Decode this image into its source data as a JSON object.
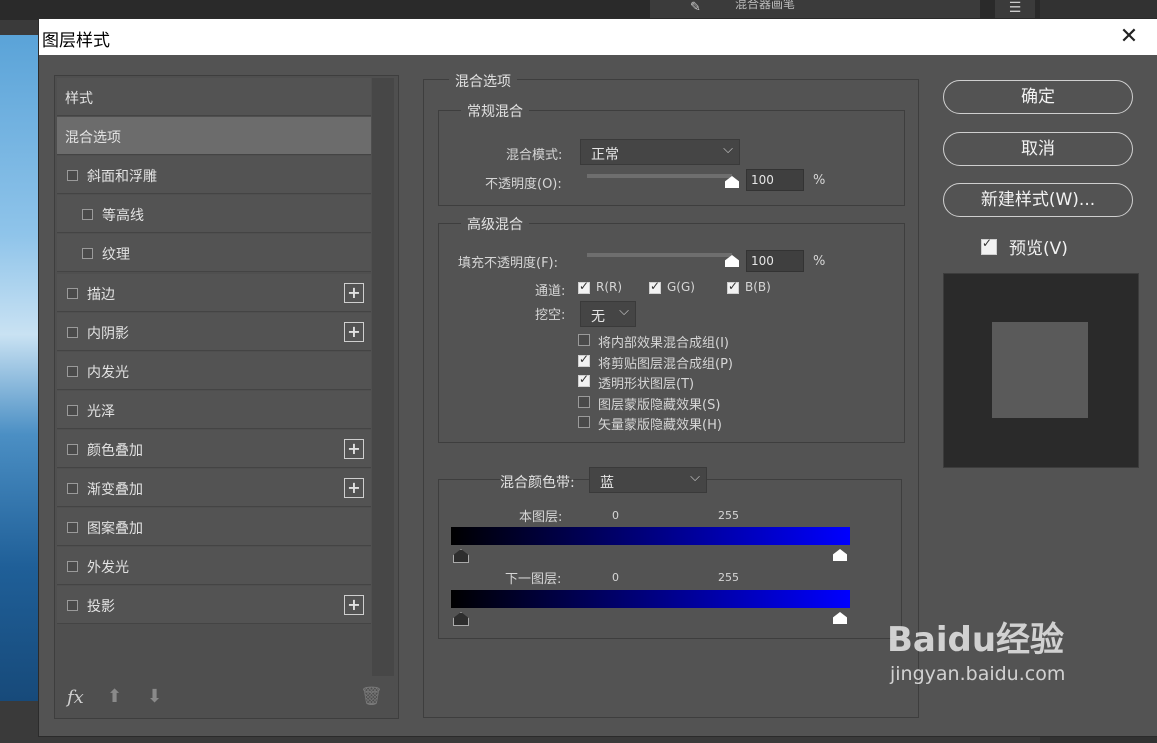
{
  "dialog": {
    "title": "图层样式"
  },
  "left_panel": {
    "items": [
      {
        "label": "样式",
        "checkbox": false,
        "plus": false,
        "indent": 0,
        "selected": false
      },
      {
        "label": "混合选项",
        "checkbox": false,
        "plus": false,
        "indent": 0,
        "selected": true
      },
      {
        "label": "斜面和浮雕",
        "checkbox": true,
        "plus": false,
        "indent": 0,
        "selected": false
      },
      {
        "label": "等高线",
        "checkbox": true,
        "plus": false,
        "indent": 1,
        "selected": false
      },
      {
        "label": "纹理",
        "checkbox": true,
        "plus": false,
        "indent": 1,
        "selected": false
      },
      {
        "label": "描边",
        "checkbox": true,
        "plus": true,
        "indent": 0,
        "selected": false
      },
      {
        "label": "内阴影",
        "checkbox": true,
        "plus": true,
        "indent": 0,
        "selected": false
      },
      {
        "label": "内发光",
        "checkbox": true,
        "plus": false,
        "indent": 0,
        "selected": false
      },
      {
        "label": "光泽",
        "checkbox": true,
        "plus": false,
        "indent": 0,
        "selected": false
      },
      {
        "label": "颜色叠加",
        "checkbox": true,
        "plus": true,
        "indent": 0,
        "selected": false
      },
      {
        "label": "渐变叠加",
        "checkbox": true,
        "plus": true,
        "indent": 0,
        "selected": false
      },
      {
        "label": "图案叠加",
        "checkbox": true,
        "plus": false,
        "indent": 0,
        "selected": false
      },
      {
        "label": "外发光",
        "checkbox": true,
        "plus": false,
        "indent": 0,
        "selected": false
      },
      {
        "label": "投影",
        "checkbox": true,
        "plus": true,
        "indent": 0,
        "selected": false
      }
    ],
    "footer": {
      "fx": "fx",
      "up_icon": "arrow-up-icon",
      "down_icon": "arrow-down-icon",
      "trash_icon": "trash-icon"
    }
  },
  "blend": {
    "section_title": "混合选项",
    "general": {
      "title": "常规混合",
      "mode_label": "混合模式:",
      "mode_value": "正常",
      "opacity_label": "不透明度(O):",
      "opacity_value": "100",
      "opacity_unit": "%",
      "opacity_fraction": 1.0
    },
    "advanced": {
      "title": "高级混合",
      "fill_label": "填充不透明度(F):",
      "fill_value": "100",
      "fill_unit": "%",
      "fill_fraction": 1.0,
      "channels_label": "通道:",
      "channels": [
        {
          "label": "R(R)",
          "checked": true
        },
        {
          "label": "G(G)",
          "checked": true
        },
        {
          "label": "B(B)",
          "checked": true
        }
      ],
      "knockout_label": "挖空:",
      "knockout_value": "无",
      "options": [
        {
          "label": "将内部效果混合成组(I)",
          "checked": false
        },
        {
          "label": "将剪贴图层混合成组(P)",
          "checked": true
        },
        {
          "label": "透明形状图层(T)",
          "checked": true
        },
        {
          "label": "图层蒙版隐藏效果(S)",
          "checked": false
        },
        {
          "label": "矢量蒙版隐藏效果(H)",
          "checked": false
        }
      ]
    },
    "blend_if": {
      "label": "混合颜色带:",
      "value": "蓝",
      "this_layer_label": "本图层:",
      "under_layer_label": "下一图层:",
      "min": "0",
      "max": "255",
      "ramp_colors": [
        "#000000",
        "#0000ff"
      ]
    }
  },
  "buttons": {
    "ok": "确定",
    "cancel": "取消",
    "new_style": "新建样式(W)...",
    "preview_label": "预览(V)",
    "preview_checked": true
  },
  "background": {
    "brush_label": "混合器画笔"
  },
  "watermark": {
    "logo": "Baidu经验",
    "url": "jingyan.baidu.com"
  }
}
